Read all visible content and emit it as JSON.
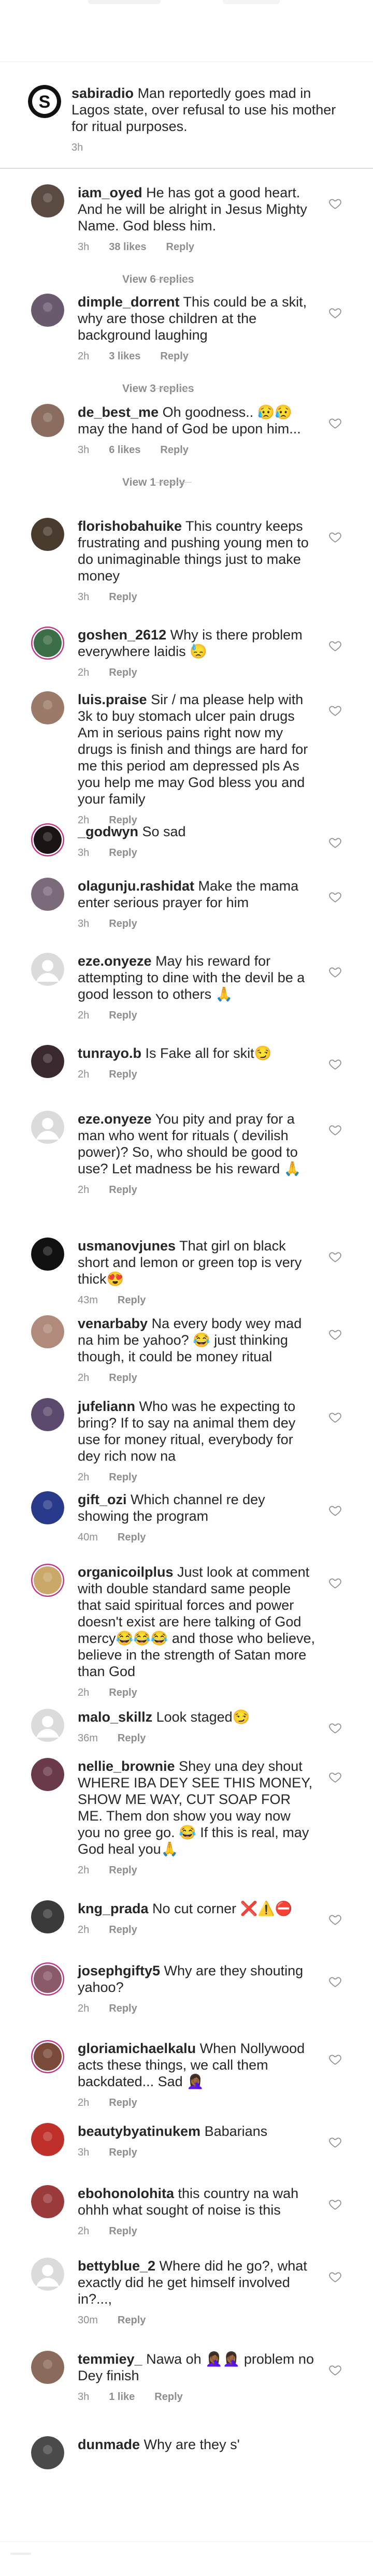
{
  "caption": {
    "username": "sabiradio",
    "text": "Man reportedly goes mad in Lagos state, over refusal to use his mother for ritual purposes.",
    "time": "3h",
    "avatar_color": "#000000"
  },
  "comments": [
    {
      "username": "iam_oyed",
      "text": "He has got a good heart. And he will be alright in Jesus Mighty Name. God bless him.",
      "time": "3h",
      "likes": "38 likes",
      "reply": "Reply",
      "view_replies": "View 6 replies",
      "avatar_color": "#5a4a42"
    },
    {
      "username": "dimple_dorrent",
      "text": "This could be a skit, why are those children at the background laughing",
      "time": "2h",
      "likes": "3 likes",
      "reply": "Reply",
      "view_replies": "View 3 replies",
      "avatar_color": "#6a5a6e"
    },
    {
      "username": "de_best_me",
      "text": "Oh goodness.. 😥😥 may the hand of God be upon him...",
      "time": "3h",
      "likes": "6 likes",
      "reply": "Reply",
      "view_replies": "View 1 reply",
      "avatar_color": "#8a6d5f"
    },
    {
      "username": "florishobahuike",
      "text": "This country keeps frustrating and pushing young men to do unimaginable things just to make money",
      "time": "3h",
      "likes": "",
      "reply": "Reply",
      "avatar_color": "#4a3b2f"
    },
    {
      "username": "goshen_2612",
      "text": "Why is there problem everywhere laidis 😓",
      "time": "2h",
      "likes": "",
      "reply": "Reply",
      "avatar_color": "#3c6e47",
      "ring": true
    },
    {
      "username": "luis.praise",
      "text": "Sir / ma please help with 3k to buy stomach ulcer pain drugs Am in serious pains right now my drugs is finish and things are hard for me this period am depressed pls As you help me may God bless you and your family",
      "time": "2h",
      "likes": "",
      "reply": "Reply",
      "avatar_color": "#9b7a6a"
    },
    {
      "username": "_godwyn",
      "text": "So sad",
      "time": "3h",
      "likes": "",
      "reply": "Reply",
      "avatar_color": "#1a1414",
      "ring": true
    },
    {
      "username": "olagunju.rashidat",
      "text": "Make the mama enter serious prayer for him",
      "time": "3h",
      "likes": "",
      "reply": "Reply",
      "avatar_color": "#7a6a7a"
    },
    {
      "username": "eze.onyeze",
      "text": "May his reward for attempting to dine with the devil be a good lesson to others 🙏",
      "time": "2h",
      "likes": "",
      "reply": "Reply",
      "avatar_color": "#dbdbdb",
      "default_avatar": true
    },
    {
      "username": "tunrayo.b",
      "text": "Is Fake all for skit😏",
      "time": "2h",
      "likes": "",
      "reply": "Reply",
      "avatar_color": "#3a2a30"
    },
    {
      "username": "eze.onyeze",
      "text": "You pity and pray for a man who went for rituals ( devilish power)? So, who should be good to use? Let madness be his reward 🙏",
      "time": "2h",
      "likes": "",
      "reply": "Reply",
      "avatar_color": "#dbdbdb",
      "default_avatar": true
    },
    {
      "username": "usmanovjunes",
      "text": "That girl on black short and lemon or green top is very thick😍",
      "time": "43m",
      "likes": "",
      "reply": "Reply",
      "avatar_color": "#111111"
    },
    {
      "username": "venarbaby",
      "text": "Na every body wey mad na him be yahoo? 😂 just thinking though, it could be money ritual",
      "time": "2h",
      "likes": "",
      "reply": "Reply",
      "avatar_color": "#b08a7a"
    },
    {
      "username": "jufeliann",
      "text": "Who was he expecting to bring? If to say na animal them dey use for money ritual, everybody for dey rich now na",
      "time": "2h",
      "likes": "",
      "reply": "Reply",
      "avatar_color": "#5c4a6e"
    },
    {
      "username": "gift_ozi",
      "text": "Which channel re dey showing the program",
      "time": "40m",
      "likes": "",
      "reply": "Reply",
      "avatar_color": "#2a3a8a"
    },
    {
      "username": "organicoilplus",
      "text": "Just look at comment with double standard same people that said spiritual forces and power doesn't exist are here talking of God mercy😂😂😂 and those who believe, believe in the strength of Satan more than God",
      "time": "2h",
      "likes": "",
      "reply": "Reply",
      "avatar_color": "#c9a86a",
      "ring": true
    },
    {
      "username": "malo_skillz",
      "text": "Look staged😏",
      "time": "36m",
      "likes": "",
      "reply": "Reply",
      "avatar_color": "#dbdbdb",
      "default_avatar": true
    },
    {
      "username": "nellie_brownie",
      "text": "Shey una dey shout WHERE IBA DEY SEE THIS MONEY, SHOW ME WAY, CUT SOAP FOR ME. Them don show you way now you no gree go. 😂 If this is real, may God heal you🙏",
      "time": "2h",
      "likes": "",
      "reply": "Reply",
      "avatar_color": "#6a3a4a"
    },
    {
      "username": "kng_prada",
      "text": "No cut corner ❌⚠️⛔",
      "time": "2h",
      "likes": "",
      "reply": "Reply",
      "avatar_color": "#3a3a3a"
    },
    {
      "username": "josephgifty5",
      "text": "Why are they shouting yahoo?",
      "time": "2h",
      "likes": "",
      "reply": "Reply",
      "avatar_color": "#8a5a6a",
      "ring": true
    },
    {
      "username": "gloriamichaelkalu",
      "text": "When Nollywood acts these things, we call them backdated... Sad 🤦🏾‍♀️",
      "time": "2h",
      "likes": "",
      "reply": "Reply",
      "avatar_color": "#7a4a3a",
      "ring": true
    },
    {
      "username": "beautybyatinukem",
      "text": "Babarians",
      "time": "3h",
      "likes": "",
      "reply": "Reply",
      "avatar_color": "#c0302a"
    },
    {
      "username": "ebohonolohita",
      "text": "this country na wah ohhh what sought of noise is this",
      "time": "2h",
      "likes": "",
      "reply": "Reply",
      "avatar_color": "#9a3a3a"
    },
    {
      "username": "bettyblue_2",
      "text": "Where did he go?, what exactly did he get himself involved in?...,",
      "time": "30m",
      "likes": "",
      "reply": "Reply",
      "avatar_color": "#dbdbdb",
      "default_avatar": true
    },
    {
      "username": "temmiey_",
      "text": "Nawa oh 🤦🏾‍♀️🤦🏾‍♀️ problem no Dey finish",
      "time": "3h",
      "likes": "1 like",
      "reply": "Reply",
      "avatar_color": "#8a6a5a"
    },
    {
      "username": "dunmade",
      "text": "Why are they s'",
      "time": "",
      "likes": "",
      "reply": "",
      "avatar_color": "#4a4a4a"
    }
  ]
}
